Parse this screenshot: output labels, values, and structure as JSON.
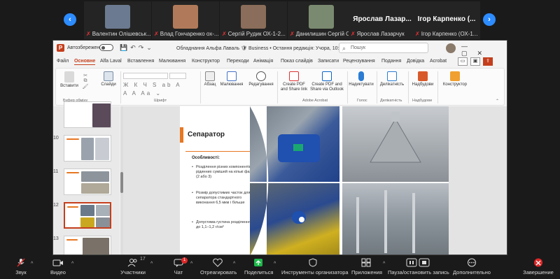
{
  "zoom_strip": {
    "participants": [
      {
        "name": "Валентин Олішевськ...",
        "face_color": "#6b7a90"
      },
      {
        "name": "Влад Гончаренко ох-...",
        "face_color": "#b07a5a"
      },
      {
        "name": "Сергій Рудик ОХ-1-2...",
        "face_color": "#8a6d5a"
      },
      {
        "name": "Данилишин Сергій ОХ-...",
        "face_color": "#7a8a70"
      },
      {
        "name": "Ярослав Лазарчук",
        "bigname": "Ярослав Лазар..."
      },
      {
        "name": "Ігор Карпенко (ОХ-1...",
        "bigname": "Ігор Карпенко (..."
      }
    ]
  },
  "ppt": {
    "autosave_label": "Автозбереження",
    "doc_title": "Обладнання Альфа Лаваль  🛡 Business • Остання редакція: Учора, 10:07 ⌄",
    "search_placeholder": "Пошук",
    "tabs": [
      "Файл",
      "Основне",
      "Alfa Laval",
      "Вставлення",
      "Малювання",
      "Конструктор",
      "Переходи",
      "Анімація",
      "Показ слайдів",
      "Записати",
      "Рецензування",
      "Подання",
      "Довідка",
      "Acrobat"
    ],
    "ribbon": {
      "paste": "Вставити",
      "slides": "Слайди",
      "paragraph": "Абзац",
      "drawing": "Малювання",
      "editing": "Редагування",
      "create_pdf_link": "Create PDF and Share link",
      "create_pdf_outlook": "Create PDF and Share via Outlook",
      "dictate": "Надиктувати",
      "sensitivity": "Делікатність",
      "addins": "Надбудови",
      "designer": "Конструктор",
      "group_clipboard": "Буфер обміну",
      "group_font": "Шрифт",
      "group_adobe": "Adobe Acrobat",
      "group_voice": "Голос",
      "group_sensitivity": "Делікатність",
      "group_addins": "Надбудови"
    },
    "thumbnails": [
      {
        "num": ""
      },
      {
        "num": "10"
      },
      {
        "num": "11"
      },
      {
        "num": "12",
        "selected": true
      },
      {
        "num": "13"
      }
    ],
    "slide": {
      "title": "Сепаратор",
      "features_heading": "Особливості:",
      "bullets": [
        "Розділення різних компонентів рідинних сумішей на кількі фаз (2 або 3)",
        "Розмір допустимих часток для сепаратора стандартного виконання 6,5 мкм і більше",
        "Допустима густина розділення до 1,1–1,2 г/см³"
      ]
    }
  },
  "zoom_bar": {
    "buttons": [
      {
        "label": "Звук",
        "icon": "microphone-muted-icon"
      },
      {
        "label": "Видео",
        "icon": "video-icon"
      },
      {
        "label": "Участники",
        "icon": "participants-icon",
        "count": "17"
      },
      {
        "label": "Чат",
        "icon": "chat-icon",
        "badge": "1"
      },
      {
        "label": "Отреагировать",
        "icon": "heart-icon"
      },
      {
        "label": "Поделиться",
        "icon": "share-screen-icon"
      },
      {
        "label": "Инструменты организатора",
        "icon": "shield-icon"
      },
      {
        "label": "Приложения",
        "icon": "apps-icon"
      },
      {
        "label": "Пауза/остановить запись",
        "icon": "record-icon"
      },
      {
        "label": "Дополнительно",
        "icon": "more-icon"
      },
      {
        "label": "Завершение",
        "icon": "end-call-icon"
      }
    ],
    "colors": {
      "accent": "#2d8cff",
      "share": "#1eb84a",
      "end": "#e02828"
    }
  }
}
